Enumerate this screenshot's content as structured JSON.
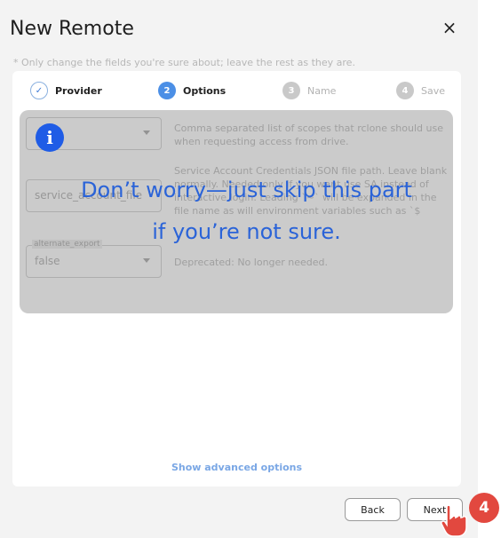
{
  "dialog": {
    "title": "New Remote",
    "close_glyph": "×",
    "hint": "* Only change the fields you're sure about; leave the rest as they are."
  },
  "steps": [
    {
      "num": "✓",
      "label": "Provider",
      "state": "done"
    },
    {
      "num": "2",
      "label": "Options",
      "state": "active"
    },
    {
      "num": "3",
      "label": "Name",
      "state": "todo"
    },
    {
      "num": "4",
      "label": "Save",
      "state": "todo"
    }
  ],
  "fields": [
    {
      "legend": "",
      "value": "",
      "type": "select",
      "description": "Comma separated list of scopes that rclone should use when requesting access from drive."
    },
    {
      "legend": "",
      "value": "service_account_file",
      "type": "text",
      "description": "Service Account Credentials JSON file path.  Leave blank normally. Needed only if you want use SA instead of interactive login.  Leading `~` will be expanded in the file name as will environment variables such as `$"
    },
    {
      "legend": "alternate_export",
      "value": "false",
      "type": "select",
      "description": "Deprecated: No longer needed."
    }
  ],
  "overlay": {
    "icon": "info-icon",
    "info_glyph": "i",
    "line1": "Don’t worry—just skip this part",
    "line2": "if you’re not sure."
  },
  "advanced_label": "Show advanced options",
  "buttons": {
    "back": "Back",
    "next": "Next"
  },
  "tutorial_step": "4",
  "colors": {
    "accent": "#4b8fe6",
    "tip_text": "#2a63d8",
    "badge": "#e2483f",
    "info_icon": "#1f5ce6"
  }
}
